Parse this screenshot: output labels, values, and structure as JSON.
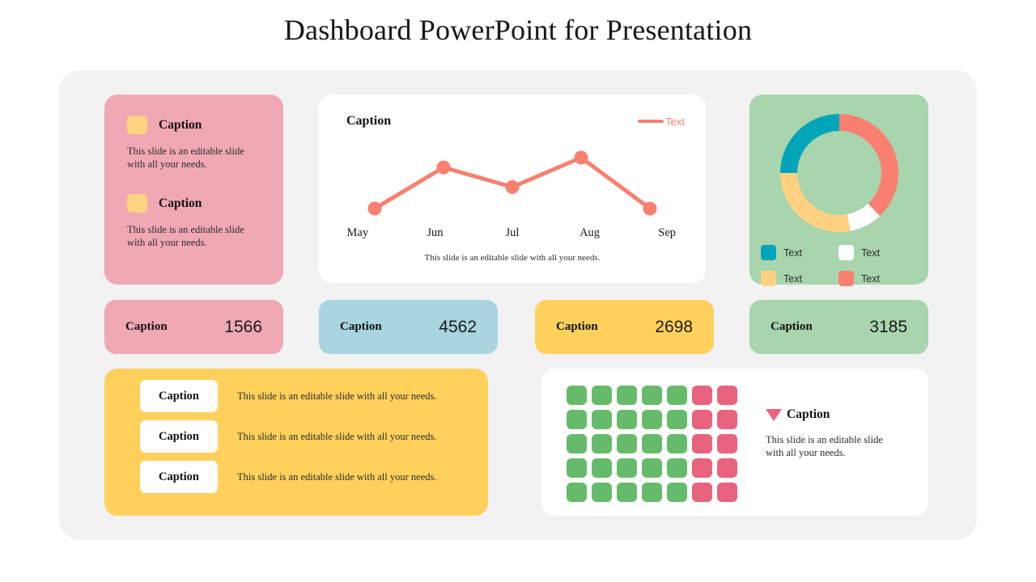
{
  "title": "Dashboard PowerPoint for Presentation",
  "colors": {
    "panel_bg": "#f2f2f2",
    "pink": "#f0a8b4",
    "blue": "#a8d5e0",
    "yellow": "#ffd15c",
    "green": "#a8d5ad",
    "salmon": "#f98070",
    "teal": "#00a5ba",
    "light_yellow": "#ffd480",
    "white": "#ffffff",
    "waffle_green": "#66bb6a",
    "waffle_pink": "#e8637d"
  },
  "pink_info_card": {
    "blocks": [
      {
        "swatch_color": "#ffd480",
        "label": "Caption",
        "body": "This slide is an editable slide with all your needs."
      },
      {
        "swatch_color": "#ffd480",
        "label": "Caption",
        "body": "This slide is an editable slide with all your needs."
      }
    ]
  },
  "chart_data": {
    "type": "line",
    "title": "Caption",
    "xlabel": "",
    "ylabel": "",
    "grid": false,
    "legend_position": "top-right",
    "legend": [
      {
        "name": "Text",
        "color": "#f98070"
      }
    ],
    "categories": [
      "May",
      "Jun",
      "Jul",
      "Aug",
      "Sep"
    ],
    "series": [
      {
        "name": "Text",
        "color": "#f98070",
        "values": [
          20,
          62,
          42,
          72,
          20
        ]
      }
    ],
    "ylim": [
      0,
      100
    ],
    "footnote": "This slide is an editable slide with all your needs."
  },
  "donut_card": {
    "chart": {
      "type": "pie",
      "title": "",
      "donut": true,
      "labels": [
        "Text",
        "Text",
        "Text",
        "Text"
      ],
      "values": [
        38,
        9,
        28,
        25
      ],
      "colors": [
        "#f98070",
        "#ffffff",
        "#ffd180",
        "#00a5ba"
      ]
    },
    "legend": [
      {
        "label": "Text",
        "color": "#00a5ba"
      },
      {
        "label": "Text",
        "color": "#ffffff"
      },
      {
        "label": "Text",
        "color": "#ffd180"
      },
      {
        "label": "Text",
        "color": "#f98070"
      }
    ]
  },
  "stats": [
    {
      "label": "Caption",
      "value": "1566",
      "color": "#f0a8b4"
    },
    {
      "label": "Caption",
      "value": "4562",
      "color": "#a8d5e0"
    },
    {
      "label": "Caption",
      "value": "2698",
      "color": "#ffd15c"
    },
    {
      "label": "Caption",
      "value": "3185",
      "color": "#a8d5ad"
    }
  ],
  "list_card": {
    "rows": [
      {
        "pill": "Caption",
        "text": "This slide is an editable slide with all your needs."
      },
      {
        "pill": "Caption",
        "text": "This slide is an editable slide with all your needs."
      },
      {
        "pill": "Caption",
        "text": "This slide is an editable slide with all your needs."
      }
    ]
  },
  "waffle_card": {
    "chart": {
      "type": "heatmap",
      "columns": 7,
      "rows": 5,
      "green_columns": 5,
      "pink_columns": 2,
      "green_count": 25,
      "pink_count": 10,
      "total": 35,
      "green_color": "#66bb6a",
      "pink_color": "#e8637d"
    },
    "marker_icon": "triangle-down-icon",
    "title": "Caption",
    "body": "This slide is an editable slide with all your needs."
  }
}
